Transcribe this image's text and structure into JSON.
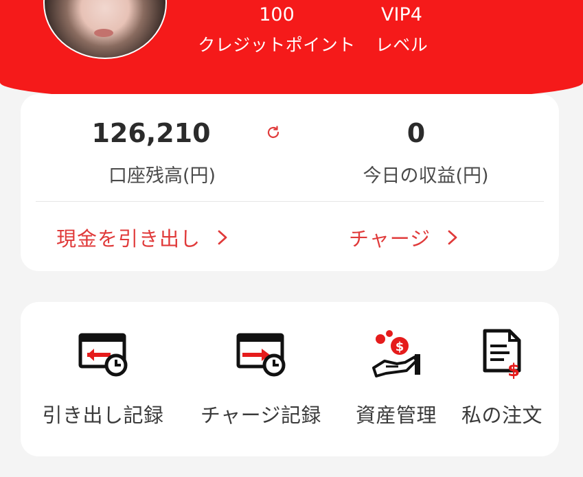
{
  "header": {
    "stats": [
      {
        "value": "100",
        "label": "クレジットポイント"
      },
      {
        "value": "VIP4",
        "label": "レベル"
      }
    ]
  },
  "balance": {
    "account_balance": "126,210",
    "account_balance_label": "口座残高(円)",
    "today_earnings": "0",
    "today_earnings_label": "今日の収益(円)",
    "withdraw_label": "現金を引き出し",
    "charge_label": "チャージ"
  },
  "menu": {
    "items": [
      {
        "label": "引き出し記録",
        "icon": "withdraw-record-icon"
      },
      {
        "label": "チャージ記録",
        "icon": "charge-record-icon"
      },
      {
        "label": "資産管理",
        "icon": "asset-management-icon"
      },
      {
        "label": "私の注文",
        "icon": "my-order-icon"
      }
    ]
  },
  "colors": {
    "brand_red": "#f51a1a",
    "accent_red": "#e03a3a",
    "icon_black": "#111111",
    "icon_red": "#e51c1c"
  }
}
